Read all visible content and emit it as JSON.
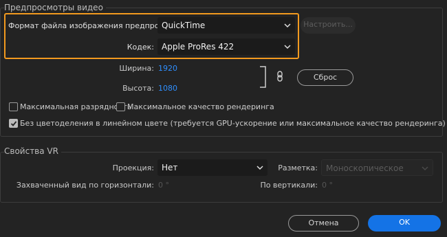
{
  "previews": {
    "title": "Предпросмотры видео",
    "format_label": "Формат файла изображения предпросмотра:",
    "format_value": "QuickTime",
    "codec_label": "Кодек:",
    "codec_value": "Apple ProRes 422",
    "configure_button": "Настроить...",
    "width_label": "Ширина:",
    "width_value": "1920",
    "height_label": "Высота:",
    "height_value": "1080",
    "reset_button": "Сброс",
    "max_bit_depth": {
      "label": "Максимальная разрядность",
      "checked": false
    },
    "max_render_quality": {
      "label": "Максимальное качество рендеринга",
      "checked": false
    },
    "linear_color": {
      "label": "Без цветоделения в линейном цвете (требуется GPU-ускорение или максимальное качество рендеринга)",
      "checked": true
    }
  },
  "vr": {
    "title": "Свойства VR",
    "projection_label": "Проекция:",
    "projection_value": "Нет",
    "layout_label": "Разметка:",
    "layout_value": "Моноскопическое",
    "horizontal_label": "Захваченный вид по горизонтали:",
    "horizontal_value": "0 °",
    "vertical_label": "По вертикали:",
    "vertical_value": "0 °"
  },
  "footer": {
    "cancel_button": "Отмена",
    "ok_button": "OK"
  },
  "colors": {
    "accent": "#1473e6",
    "highlight": "#f39a1e",
    "value": "#2f8fff"
  }
}
